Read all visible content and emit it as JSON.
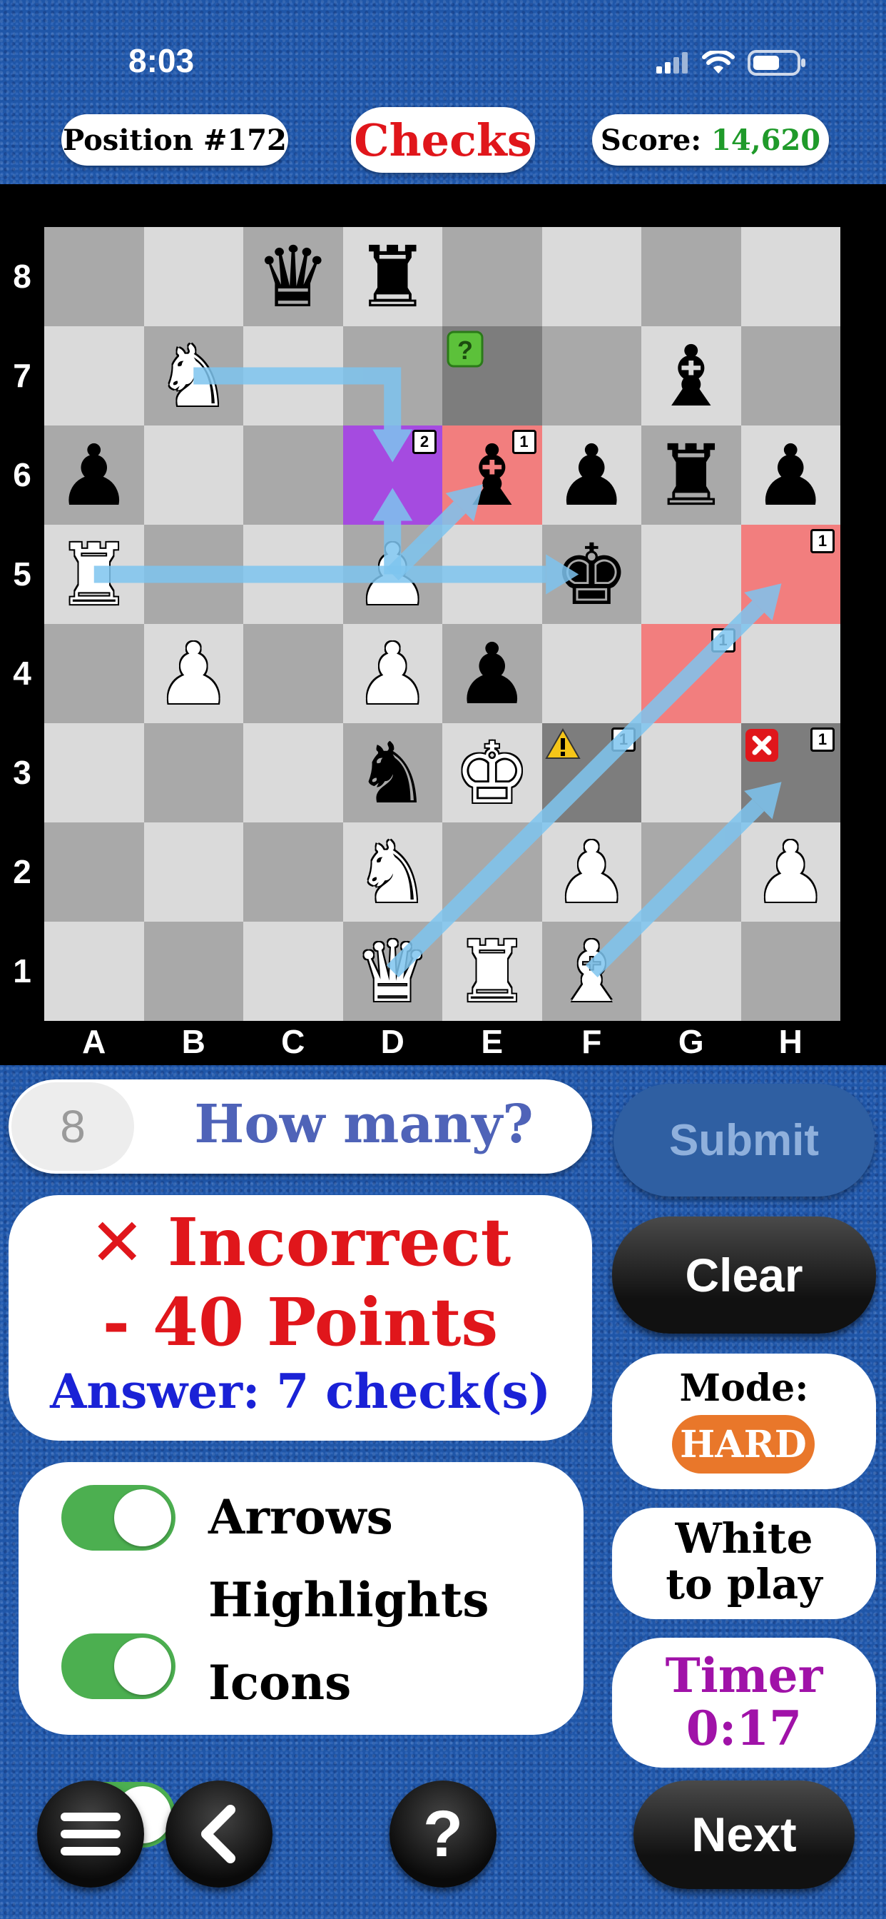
{
  "status_bar": {
    "time": "8:03"
  },
  "header": {
    "position_label": "Position #172",
    "mode_title": "Checks",
    "score_prefix": "Score:",
    "score_value": "14,620"
  },
  "board": {
    "ranks": [
      "8",
      "7",
      "6",
      "5",
      "4",
      "3",
      "2",
      "1"
    ],
    "files": [
      "A",
      "B",
      "C",
      "D",
      "E",
      "F",
      "G",
      "H"
    ],
    "pieces": [
      {
        "sq": "c8",
        "glyph": "♛",
        "color": "black"
      },
      {
        "sq": "d8",
        "glyph": "♜",
        "color": "black"
      },
      {
        "sq": "b7",
        "glyph": "♞",
        "color": "white"
      },
      {
        "sq": "g7",
        "glyph": "♝",
        "color": "black"
      },
      {
        "sq": "a6",
        "glyph": "♟",
        "color": "black"
      },
      {
        "sq": "e6",
        "glyph": "♝",
        "color": "black"
      },
      {
        "sq": "f6",
        "glyph": "♟",
        "color": "black"
      },
      {
        "sq": "g6",
        "glyph": "♜",
        "color": "black"
      },
      {
        "sq": "h6",
        "glyph": "♟",
        "color": "black"
      },
      {
        "sq": "a5",
        "glyph": "♜",
        "color": "white"
      },
      {
        "sq": "d5",
        "glyph": "♟",
        "color": "white"
      },
      {
        "sq": "f5",
        "glyph": "♚",
        "color": "black"
      },
      {
        "sq": "b4",
        "glyph": "♟",
        "color": "white"
      },
      {
        "sq": "d4",
        "glyph": "♟",
        "color": "white"
      },
      {
        "sq": "e4",
        "glyph": "♟",
        "color": "black"
      },
      {
        "sq": "d3",
        "glyph": "♞",
        "color": "black"
      },
      {
        "sq": "e3",
        "glyph": "♚",
        "color": "white"
      },
      {
        "sq": "d2",
        "glyph": "♞",
        "color": "white"
      },
      {
        "sq": "f2",
        "glyph": "♟",
        "color": "white"
      },
      {
        "sq": "h2",
        "glyph": "♟",
        "color": "white"
      },
      {
        "sq": "d1",
        "glyph": "♛",
        "color": "white"
      },
      {
        "sq": "e1",
        "glyph": "♜",
        "color": "white"
      },
      {
        "sq": "f1",
        "glyph": "♝",
        "color": "white"
      }
    ],
    "highlights": [
      {
        "sq": "d6",
        "type": "purple"
      },
      {
        "sq": "e6",
        "type": "red"
      },
      {
        "sq": "h5",
        "type": "red"
      },
      {
        "sq": "g4",
        "type": "red"
      },
      {
        "sq": "e7",
        "type": "gray"
      },
      {
        "sq": "f3",
        "type": "gray"
      },
      {
        "sq": "h3",
        "type": "gray"
      }
    ],
    "badges": [
      {
        "sq": "d6",
        "text": "2"
      },
      {
        "sq": "e6",
        "text": "1"
      },
      {
        "sq": "h5",
        "text": "1"
      },
      {
        "sq": "g4",
        "text": "1"
      },
      {
        "sq": "f3",
        "text": "1"
      },
      {
        "sq": "h3",
        "text": "1"
      }
    ],
    "icons": [
      {
        "sq": "e7",
        "name": "question-icon"
      },
      {
        "sq": "f3",
        "name": "warning-icon"
      },
      {
        "sq": "h3",
        "name": "error-icon"
      }
    ],
    "arrows": [
      {
        "from": "b7",
        "to": "d6",
        "via": "d7"
      },
      {
        "from": "d5",
        "to": "d6"
      },
      {
        "from": "d5",
        "to": "e6"
      },
      {
        "from": "a5",
        "to": "f5"
      },
      {
        "from": "d1",
        "to": "h5"
      },
      {
        "from": "f1",
        "to": "h3"
      }
    ],
    "arrow_color": "#7ec4ef"
  },
  "answer_input": {
    "value": "8",
    "prompt": "How many?"
  },
  "submit_label": "Submit",
  "clear_label": "Clear",
  "result": {
    "icon": "✕",
    "title": "Incorrect",
    "points": "- 40 Points",
    "answer": "Answer: 7 check(s)"
  },
  "toggles": [
    {
      "label": "Arrows",
      "on": true
    },
    {
      "label": "Highlights",
      "on": true
    },
    {
      "label": "Icons",
      "on": true
    }
  ],
  "mode": {
    "label": "Mode:",
    "value": "HARD"
  },
  "turn": {
    "line1": "White",
    "line2": "to play"
  },
  "timer": {
    "label": "Timer",
    "value": "0:17"
  },
  "nav": {
    "next_label": "Next"
  },
  "colors": {
    "title_red": "#e0161b",
    "score_green": "#1f9a2a",
    "prompt_blue": "#4f63b8",
    "answer_blue": "#1a22d6",
    "timer_purple": "#a012a8",
    "hard_orange": "#e9772a"
  }
}
